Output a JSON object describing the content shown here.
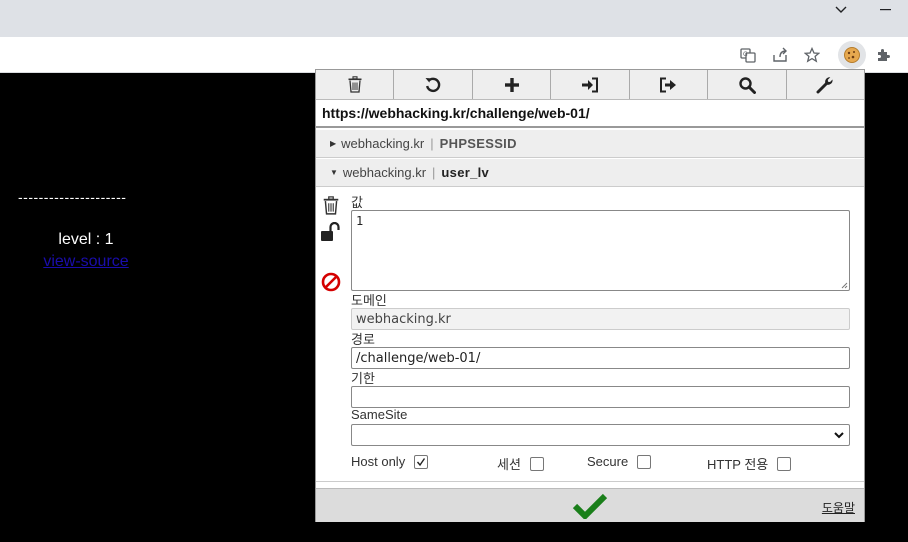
{
  "browser": {
    "minimize_glyph": "—",
    "chevron_glyph": "⌵",
    "icons": [
      "translate-icon",
      "share-icon",
      "star-icon",
      "cookie-extension-icon",
      "extensions-icon"
    ]
  },
  "page": {
    "dashes": "---------------------",
    "level_text": "level : 1",
    "view_source_link": "view-source"
  },
  "popup": {
    "toolbar": [
      "delete-all-icon",
      "reset-icon",
      "add-icon",
      "import-icon",
      "export-icon",
      "search-icon",
      "options-icon"
    ],
    "url": "https://webhacking.kr/challenge/web-01/",
    "cookies": [
      {
        "domain": "webhacking.kr",
        "separator": "|",
        "name": "PHPSESSID",
        "expanded": false
      },
      {
        "domain": "webhacking.kr",
        "separator": "|",
        "name": "user_lv",
        "expanded": true
      }
    ],
    "detail": {
      "value_label": "값",
      "value": "1",
      "domain_label": "도메인",
      "domain_value": "webhacking.kr",
      "path_label": "경로",
      "path_value": "/challenge/web-01/",
      "expiry_label": "기한",
      "expiry_value": "",
      "samesite_label": "SameSite",
      "samesite_value": "",
      "flags": [
        {
          "label": "Host only",
          "checked": true
        },
        {
          "label": "세션",
          "checked": false
        },
        {
          "label": "Secure",
          "checked": false
        },
        {
          "label": "HTTP 전용",
          "checked": false
        }
      ]
    },
    "footer": {
      "help_link": "도움말"
    },
    "colors": {
      "save_check": "#1a7f1a",
      "block_icon": "#d40000"
    }
  }
}
